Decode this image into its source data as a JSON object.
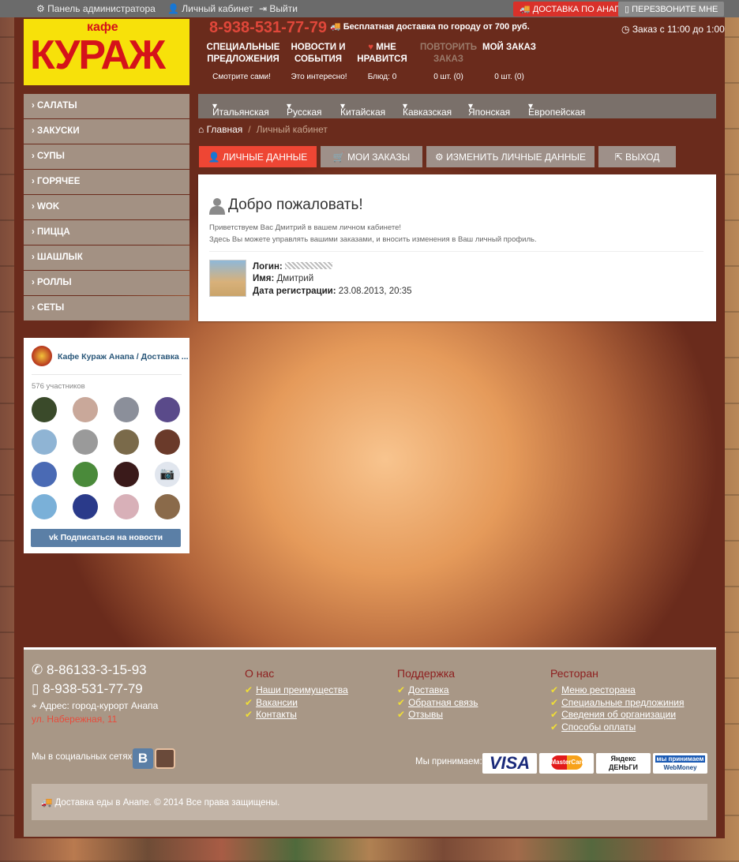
{
  "topbar": {
    "admin": "Панель администратора",
    "cabinet": "Личный кабинет",
    "logout": "Выйти",
    "delivery_btn": "ДОСТАВКА ПО АНАПЕ",
    "callback_btn": "ПЕРЕЗВОНИТЕ МНЕ"
  },
  "header": {
    "logo_small": "кафе",
    "logo_big": "КУРАЖ",
    "phone": "8-938-531-77-79",
    "delivery": "Бесплатная доставка по городу от 700 руб.",
    "hours": "Заказ с 11:00 до 1:00",
    "nav": [
      {
        "label": "СПЕЦИАЛЬНЫЕ ПРЕДЛОЖЕНИЯ",
        "sub": "Смотрите сами!"
      },
      {
        "label": "НОВОСТИ И СОБЫТИЯ",
        "sub": "Это интересно!"
      },
      {
        "label": "МНЕ НРАВИТСЯ",
        "sub": "Блюд: 0"
      },
      {
        "label": "ПОВТОРИТЬ ЗАКАЗ",
        "sub": "0 шт. (0)"
      },
      {
        "label": "МОЙ ЗАКАЗ",
        "sub": "0 шт. (0)"
      }
    ]
  },
  "sidebar": {
    "items": [
      "САЛАТЫ",
      "ЗАКУСКИ",
      "СУПЫ",
      "ГОРЯЧЕЕ",
      "WOK",
      "ПИЦЦА",
      "ШАШЛЫК",
      "РОЛЛЫ",
      "СЕТЫ"
    ]
  },
  "vk": {
    "title": "Кафе Кураж Анапа / Доставка ...",
    "members": "576 участников",
    "subscribe": "Подписаться на новости"
  },
  "cuisines": [
    "Итальянская",
    "Русская",
    "Китайская",
    "Кавказская",
    "Японская",
    "Европейская"
  ],
  "breadcrumb": {
    "home": "Главная",
    "current": "Личный кабинет"
  },
  "tabs": [
    "ЛИЧНЫЕ ДАННЫЕ",
    "МОИ ЗАКАЗЫ",
    "ИЗМЕНИТЬ ЛИЧНЫЕ ДАННЫЕ",
    "ВЫХОД"
  ],
  "profile": {
    "heading": "Добро пожаловать!",
    "greeting": "Приветствуем Вас Дмитрий в вашем личном кабинете!",
    "info": "Здесь Вы можете управлять вашими заказами, и вносить изменения в Ваш личный профиль.",
    "login_label": "Логин:",
    "name_label": "Имя:",
    "name_value": "Дмитрий",
    "reg_label": "Дата регистрации:",
    "reg_value": "23.08.2013, 20:35"
  },
  "footer": {
    "phone1": "8-86133-3-15-93",
    "phone2": "8-938-531-77-79",
    "address": "Адрес: город-курорт Анапа",
    "street": "ул. Набережная, 11",
    "about": {
      "title": "О нас",
      "links": [
        "Наши преимущества",
        "Вакансии",
        "Контакты"
      ]
    },
    "support": {
      "title": "Поддержка",
      "links": [
        "Доставка",
        "Обратная связь",
        "Отзывы"
      ]
    },
    "restaurant": {
      "title": "Ресторан",
      "links": [
        "Меню ресторана",
        "Специальные предложиния",
        "Сведения об организации",
        "Способы оплаты"
      ]
    },
    "social": "Мы в социальных сетях:",
    "accept": "Мы принимаем:",
    "pay_visa": "VISA",
    "pay_mc": "MasterCard",
    "pay_yd1": "Яндекс",
    "pay_yd2": "ДЕНЬГИ",
    "pay_wm1": "мы принимаем",
    "pay_wm2": "WebMoney",
    "copyright": "Доставка еды в Анапе. © 2014 Все права защищены."
  },
  "colors": {
    "accent": "#ee4634",
    "tab_inactive": "#9e9089",
    "delivery_btn": "#d9312a"
  }
}
